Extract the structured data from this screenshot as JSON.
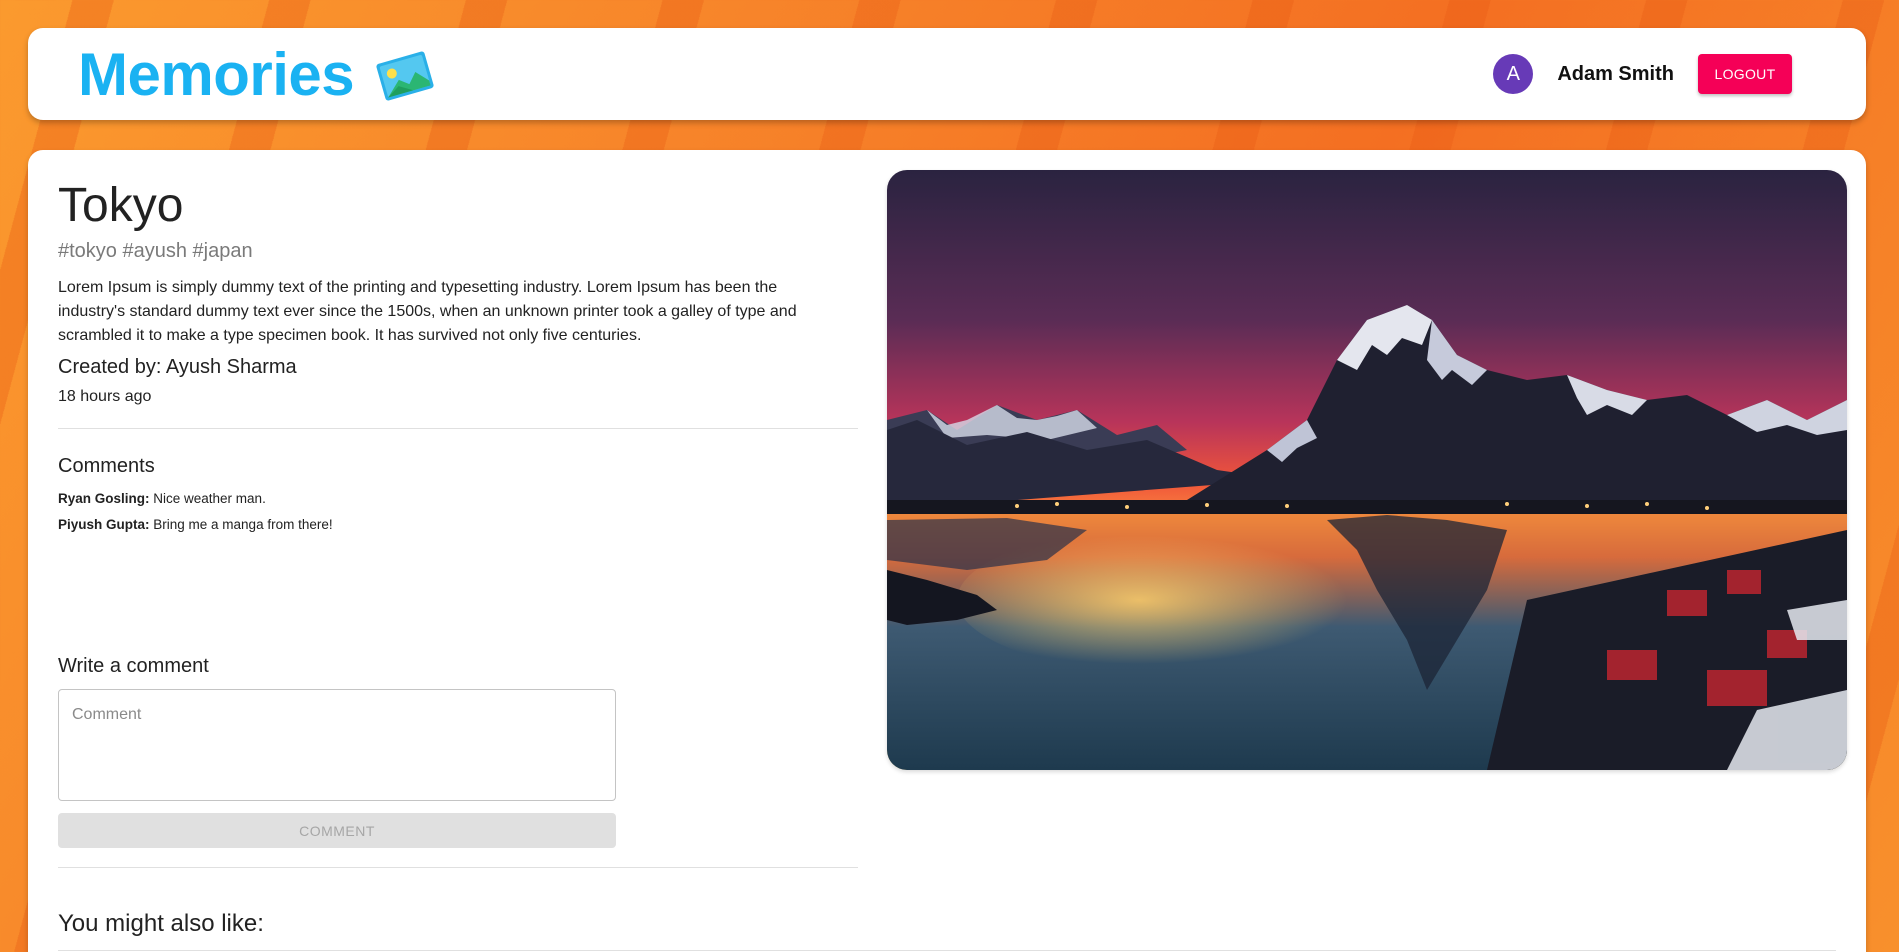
{
  "header": {
    "brand_title": "Memories",
    "brand_icon": "photo-icon",
    "user": {
      "avatar_initial": "A",
      "name": "Adam Smith",
      "avatar_color": "#673ab7"
    },
    "logout_label": "LOGOUT",
    "logout_color": "#f50057",
    "brand_color": "#1ab2f2"
  },
  "post": {
    "title": "Tokyo",
    "tags": "#tokyo #ayush #japan",
    "message": "Lorem Ipsum is simply dummy text of the printing and typesetting industry. Lorem Ipsum has been the industry's standard dummy text ever since the 1500s, when an unknown printer took a galley of type and scrambled it to make a type specimen book. It has survived not only five centuries.",
    "created_by": "Created by: Ayush Sharma",
    "time_ago": "18 hours ago",
    "image": "mountain-lake-sunset-photo"
  },
  "comments": {
    "heading": "Comments",
    "items": [
      {
        "author": "Ryan Gosling:",
        "text": " Nice weather man."
      },
      {
        "author": "Piyush Gupta:",
        "text": " Bring me a manga from there!"
      }
    ]
  },
  "write_comment": {
    "heading": "Write a comment",
    "placeholder": "Comment",
    "button_label": "COMMENT"
  },
  "recommended": {
    "heading": "You might also like:"
  }
}
